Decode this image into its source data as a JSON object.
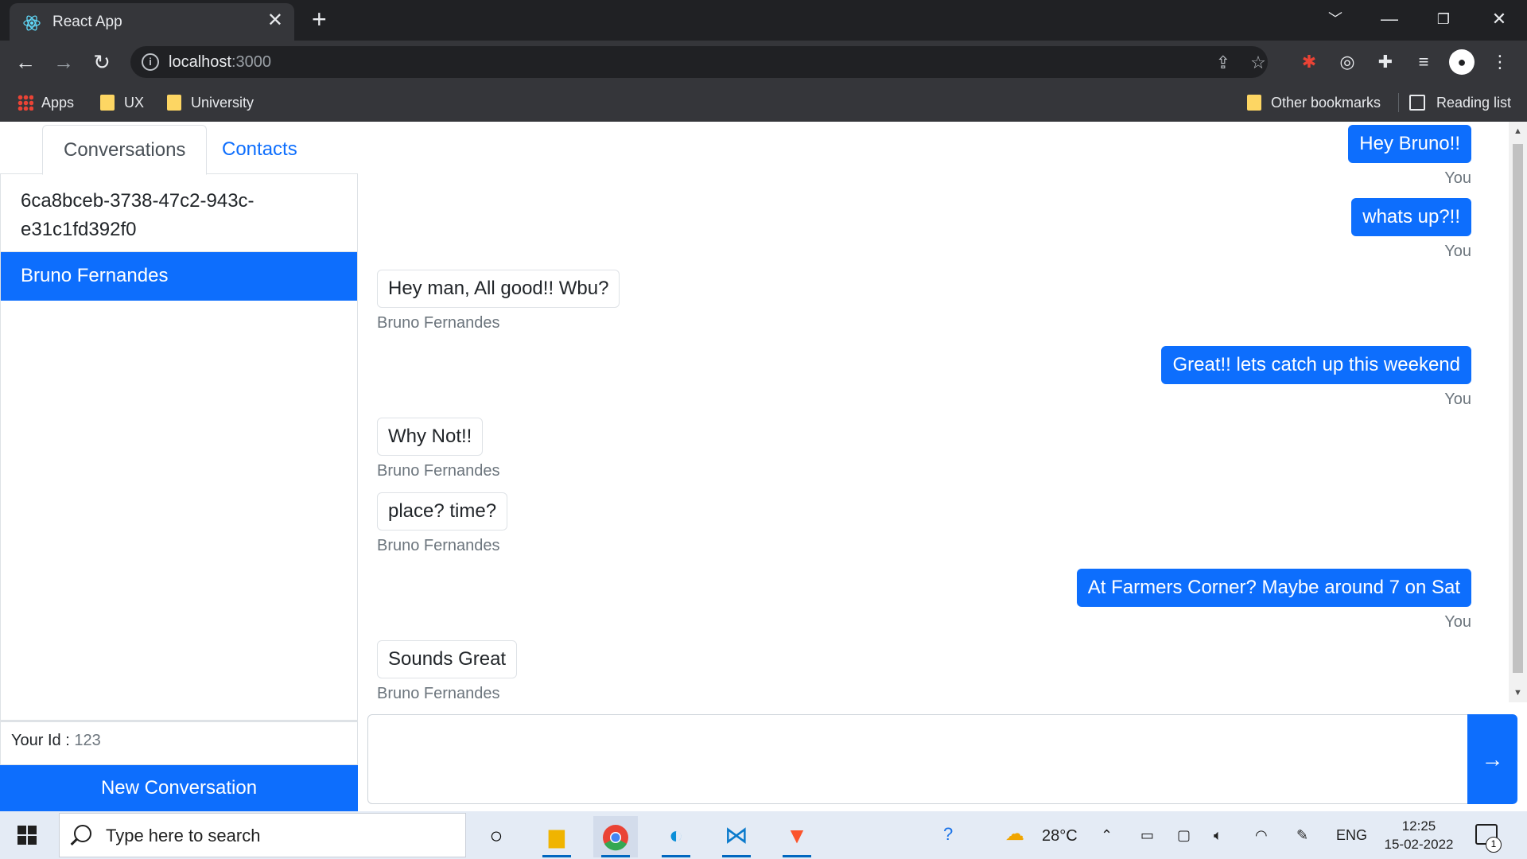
{
  "browser": {
    "tab_title": "React App",
    "url_host": "localhost",
    "url_port": ":3000",
    "bookmarks": {
      "apps": "Apps",
      "ux": "UX",
      "university": "University",
      "other": "Other bookmarks",
      "reading_list": "Reading list"
    }
  },
  "sidebar": {
    "tabs": [
      "Conversations",
      "Contacts"
    ],
    "conversations": [
      {
        "label": "6ca8bceb-3738-47c2-943c-e31c1fd392f0",
        "line1": "6ca8bceb-3738-47c2-943c-",
        "line2": "e31c1fd392f0",
        "selected": false
      },
      {
        "label": "Bruno Fernandes",
        "selected": true
      }
    ],
    "your_id_label": "Your Id : ",
    "your_id_value": "123",
    "new_conversation_label": "New Conversation"
  },
  "chat": {
    "messages": [
      {
        "text": "Hey Bruno!!",
        "sender": "You",
        "from_me": true
      },
      {
        "text": "whats up?!!",
        "sender": "You",
        "from_me": true
      },
      {
        "text": "Hey man, All good!! Wbu?",
        "sender": "Bruno Fernandes",
        "from_me": false
      },
      {
        "text": "Great!! lets catch up this weekend",
        "sender": "You",
        "from_me": true
      },
      {
        "text": "Why Not!!",
        "sender": "Bruno Fernandes",
        "from_me": false
      },
      {
        "text": "place? time?",
        "sender": "Bruno Fernandes",
        "from_me": false
      },
      {
        "text": "At Farmers Corner? Maybe around 7 on Sat",
        "sender": "You",
        "from_me": true
      },
      {
        "text": "Sounds Great",
        "sender": "Bruno Fernandes",
        "from_me": false
      }
    ],
    "composer_value": "",
    "send_icon": "arrow-right-icon"
  },
  "taskbar": {
    "search_placeholder": "Type here to search",
    "temperature": "28°C",
    "language": "ENG",
    "time": "12:25",
    "date": "15-02-2022",
    "notification_count": "1"
  },
  "colors": {
    "primary": "#0d6efd",
    "chrome_dark": "#202124",
    "chrome_toolbar": "#35363a"
  }
}
